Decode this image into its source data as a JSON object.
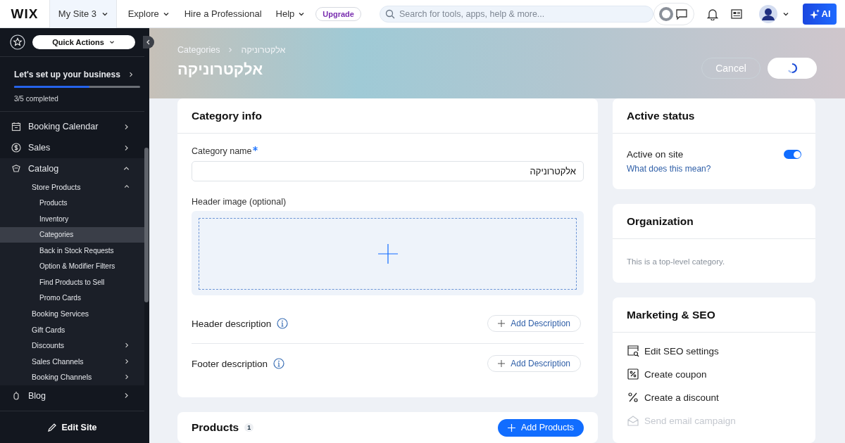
{
  "topbar": {
    "logo": "WIX",
    "site": "My Site 3",
    "menu": [
      "Explore",
      "Hire a Professional",
      "Help"
    ],
    "upgrade": "Upgrade",
    "search": {
      "placeholder": "Search for tools, apps, help & more..."
    },
    "ai": "AI"
  },
  "sidebar": {
    "quick_actions": "Quick Actions",
    "setup": {
      "title": "Let's set up your business",
      "level": 0.6,
      "progress": "3/5 completed"
    },
    "items": [
      {
        "label": "Booking Calendar",
        "expanded": false,
        "selected": false
      },
      {
        "label": "Sales",
        "expanded": false,
        "selected": false
      },
      {
        "label": "Catalog",
        "expanded": true,
        "selected": false,
        "children": [
          {
            "label": "Store Products",
            "expanded": true,
            "selected": false,
            "children": [
              {
                "label": "Products",
                "selected": false
              },
              {
                "label": "Inventory",
                "selected": false
              },
              {
                "label": "Categories",
                "selected": true
              },
              {
                "label": "Back in Stock Requests",
                "selected": false
              },
              {
                "label": "Option & Modifier Filters",
                "selected": false
              },
              {
                "label": "Find Products to Sell",
                "selected": false
              },
              {
                "label": "Promo Cards",
                "selected": false
              }
            ]
          },
          {
            "label": "Booking Services",
            "selected": false
          },
          {
            "label": "Gift Cards",
            "selected": false
          },
          {
            "label": "Discounts",
            "expanded": false,
            "selected": false
          },
          {
            "label": "Sales Channels",
            "expanded": false,
            "selected": false
          },
          {
            "label": "Booking Channels",
            "expanded": false,
            "selected": false
          }
        ]
      },
      {
        "label": "Blog",
        "expanded": false,
        "selected": false
      }
    ],
    "edit_site": "Edit Site"
  },
  "header": {
    "breadcrumb": [
      "Categories",
      "אלקטרוניקה"
    ],
    "title": "אלקטרוניקה",
    "cancel": "Cancel",
    "save_loading": true
  },
  "category_info": {
    "title": "Category info",
    "name_label": "Category name",
    "required": true,
    "name_value": "אלקטרוניקה",
    "image_label": "Header image (optional)",
    "descriptions": [
      {
        "label": "Header description",
        "button": "Add Description"
      },
      {
        "label": "Footer description",
        "button": "Add Description"
      }
    ]
  },
  "products": {
    "title": "Products",
    "count": "1",
    "button": "Add Products"
  },
  "active_status": {
    "title": "Active status",
    "label": "Active on site",
    "on": true,
    "link": "What does this mean?"
  },
  "organization": {
    "title": "Organization",
    "text": "This is a top-level category."
  },
  "marketing": {
    "title": "Marketing & SEO",
    "actions": [
      {
        "label": "Edit SEO settings",
        "disabled": false
      },
      {
        "label": "Create coupon",
        "disabled": false
      },
      {
        "label": "Create a discount",
        "disabled": false
      },
      {
        "label": "Send email campaign",
        "disabled": true
      }
    ]
  }
}
